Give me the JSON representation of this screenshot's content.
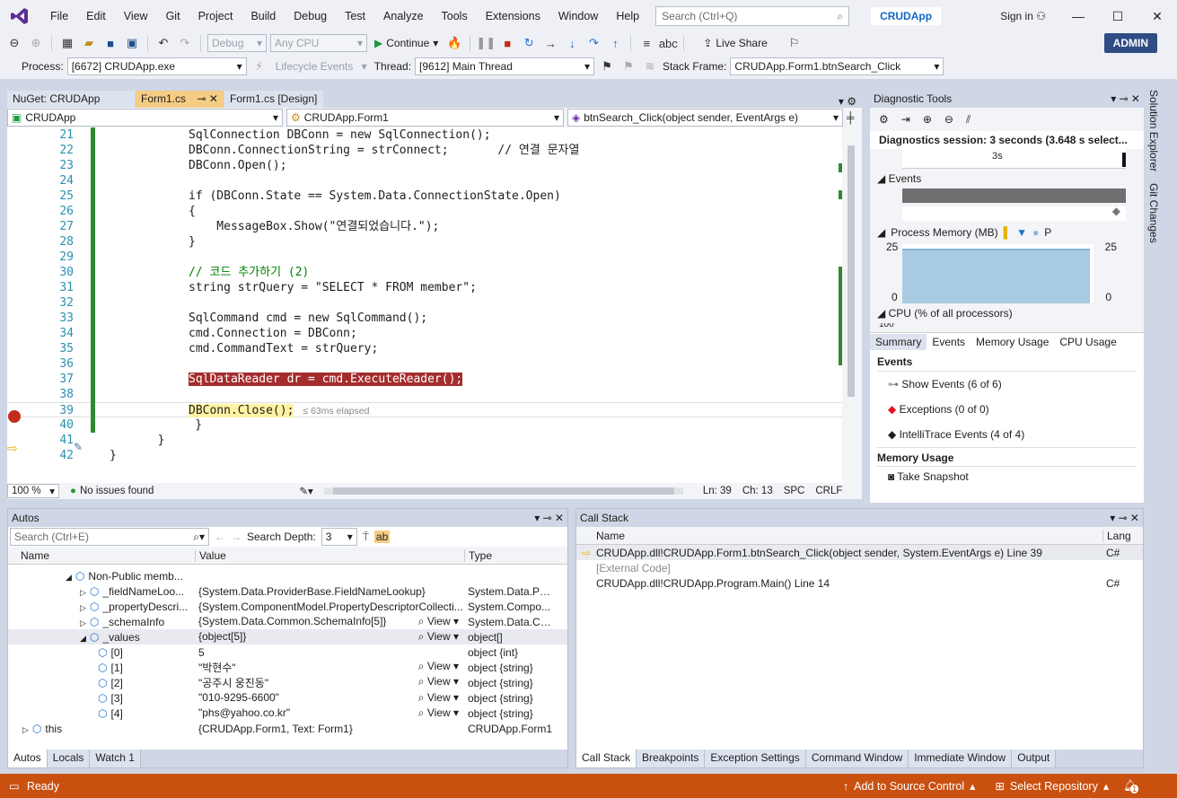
{
  "menubar": {
    "items": [
      "File",
      "Edit",
      "View",
      "Git",
      "Project",
      "Build",
      "Debug",
      "Test",
      "Analyze",
      "Tools",
      "Extensions",
      "Window",
      "Help"
    ],
    "search_placeholder": "Search (Ctrl+Q)",
    "app_name": "CRUDApp",
    "signin": "Sign in"
  },
  "toolbar": {
    "config": "Debug",
    "platform": "Any CPU",
    "continue": "Continue",
    "liveshare": "Live Share",
    "admin": "ADMIN"
  },
  "debugbar": {
    "process_label": "Process:",
    "process_value": "[6672] CRUDApp.exe",
    "lifecycle": "Lifecycle Events",
    "thread_label": "Thread:",
    "thread_value": "[9612] Main Thread",
    "stackframe_label": "Stack Frame:",
    "stackframe_value": "CRUDApp.Form1.btnSearch_Click"
  },
  "editor": {
    "tabs": [
      "NuGet: CRUDApp",
      "Form1.cs",
      "Form1.cs [Design]"
    ],
    "nav": [
      "CRUDApp",
      "CRUDApp.Form1",
      "btnSearch_Click(object sender, EventArgs e)"
    ],
    "zoom": "100 %",
    "issues": "No issues found",
    "ln": "Ln: 39",
    "ch": "Ch: 13",
    "spc": "SPC",
    "crlf": "CRLF",
    "elapsed": "≤ 63ms elapsed",
    "lines": [
      {
        "n": "21",
        "code": "SqlConnection DBConn = new SqlConnection();"
      },
      {
        "n": "22",
        "code": "DBConn.ConnectionString = strConnect;       // 연결 문자열"
      },
      {
        "n": "23",
        "code": "DBConn.Open();"
      },
      {
        "n": "24",
        "code": ""
      },
      {
        "n": "25",
        "code": "if (DBConn.State == System.Data.ConnectionState.Open)"
      },
      {
        "n": "26",
        "code": "{"
      },
      {
        "n": "27",
        "code": "    MessageBox.Show(\"연결되었습니다.\");"
      },
      {
        "n": "28",
        "code": "}"
      },
      {
        "n": "29",
        "code": ""
      },
      {
        "n": "30",
        "code": "// 코드 추가하기 (2)"
      },
      {
        "n": "31",
        "code": "string strQuery = \"SELECT * FROM member\";"
      },
      {
        "n": "32",
        "code": ""
      },
      {
        "n": "33",
        "code": "SqlCommand cmd = new SqlCommand();"
      },
      {
        "n": "34",
        "code": "cmd.Connection = DBConn;"
      },
      {
        "n": "35",
        "code": "cmd.CommandText = strQuery;"
      },
      {
        "n": "36",
        "code": ""
      },
      {
        "n": "37",
        "code": "SqlDataReader dr = cmd.ExecuteReader();"
      },
      {
        "n": "38",
        "code": ""
      },
      {
        "n": "39",
        "code": "DBConn.Close();"
      },
      {
        "n": "40",
        "code": "    }"
      },
      {
        "n": "41",
        "code": "  }"
      },
      {
        "n": "42",
        "code": "}"
      }
    ]
  },
  "diag": {
    "title": "Diagnostic Tools",
    "session": "Diagnostics session: 3 seconds (3.648 s select...",
    "tick": "3s",
    "events": "Events",
    "memory": "Process Memory (MB)",
    "mem_legend": "P",
    "mem_max": "25",
    "mem_min": "0",
    "cpu": "CPU (% of all processors)",
    "cpu_max": "100",
    "tabs": [
      "Summary",
      "Events",
      "Memory Usage",
      "CPU Usage"
    ],
    "events_header": "Events",
    "show_events": "Show Events (6 of 6)",
    "exceptions": "Exceptions (0 of 0)",
    "intellitrace": "IntelliTrace Events (4 of 4)",
    "memory_usage": "Memory Usage",
    "snapshot": "Take Snapshot",
    "side_tabs": [
      "Solution Explorer",
      "Git Changes"
    ]
  },
  "autos": {
    "title": "Autos",
    "search": "Search (Ctrl+E)",
    "depth_label": "Search Depth:",
    "depth": "3",
    "cols": [
      "Name",
      "Value",
      "Type"
    ],
    "view": "View",
    "rows": [
      {
        "indent": 4,
        "name": "Non-Public memb...",
        "value": "",
        "type": ""
      },
      {
        "indent": 5,
        "name": "_fieldNameLoo...",
        "value": "{System.Data.ProviderBase.FieldNameLookup}",
        "type": "System.Data.Pro..."
      },
      {
        "indent": 5,
        "name": "_propertyDescri...",
        "value": "{System.ComponentModel.PropertyDescriptorCollecti...",
        "type": "System.Compo..."
      },
      {
        "indent": 5,
        "name": "_schemaInfo",
        "value": "{System.Data.Common.SchemaInfo[5]}",
        "type": "System.Data.Co...",
        "view": true
      },
      {
        "indent": 5,
        "name": "_values",
        "value": "{object[5]}",
        "type": "object[]",
        "view": true
      },
      {
        "indent": 6,
        "name": "[0]",
        "value": "5",
        "type": "object {int}"
      },
      {
        "indent": 6,
        "name": "[1]",
        "value": "\"박현수\"",
        "type": "object {string}",
        "view": true
      },
      {
        "indent": 6,
        "name": "[2]",
        "value": "\"공주시 웅진동\"",
        "type": "object {string}",
        "view": true
      },
      {
        "indent": 6,
        "name": "[3]",
        "value": "\"010-9295-6600\"",
        "type": "object {string}",
        "view": true
      },
      {
        "indent": 6,
        "name": "[4]",
        "value": "\"phs@yahoo.co.kr\"",
        "type": "object {string}",
        "view": true
      },
      {
        "indent": 1,
        "name": "this",
        "value": "{CRUDApp.Form1, Text: Form1}",
        "type": "CRUDApp.Form1"
      }
    ],
    "tabs": [
      "Autos",
      "Locals",
      "Watch 1"
    ]
  },
  "callstack": {
    "title": "Call Stack",
    "cols": [
      "Name",
      "Lang"
    ],
    "rows": [
      {
        "name": "CRUDApp.dll!CRUDApp.Form1.btnSearch_Click(object sender, System.EventArgs e) Line 39",
        "lang": "C#"
      },
      {
        "name": "[External Code]",
        "lang": ""
      },
      {
        "name": "CRUDApp.dll!CRUDApp.Program.Main() Line 14",
        "lang": "C#"
      }
    ],
    "tabs": [
      "Call Stack",
      "Breakpoints",
      "Exception Settings",
      "Command Window",
      "Immediate Window",
      "Output"
    ]
  },
  "status": {
    "ready": "Ready",
    "source_control": "Add to Source Control",
    "repo": "Select Repository",
    "notif": "1"
  },
  "colors": {
    "status_bg": "#ca5010",
    "accent": "#1566c5"
  }
}
